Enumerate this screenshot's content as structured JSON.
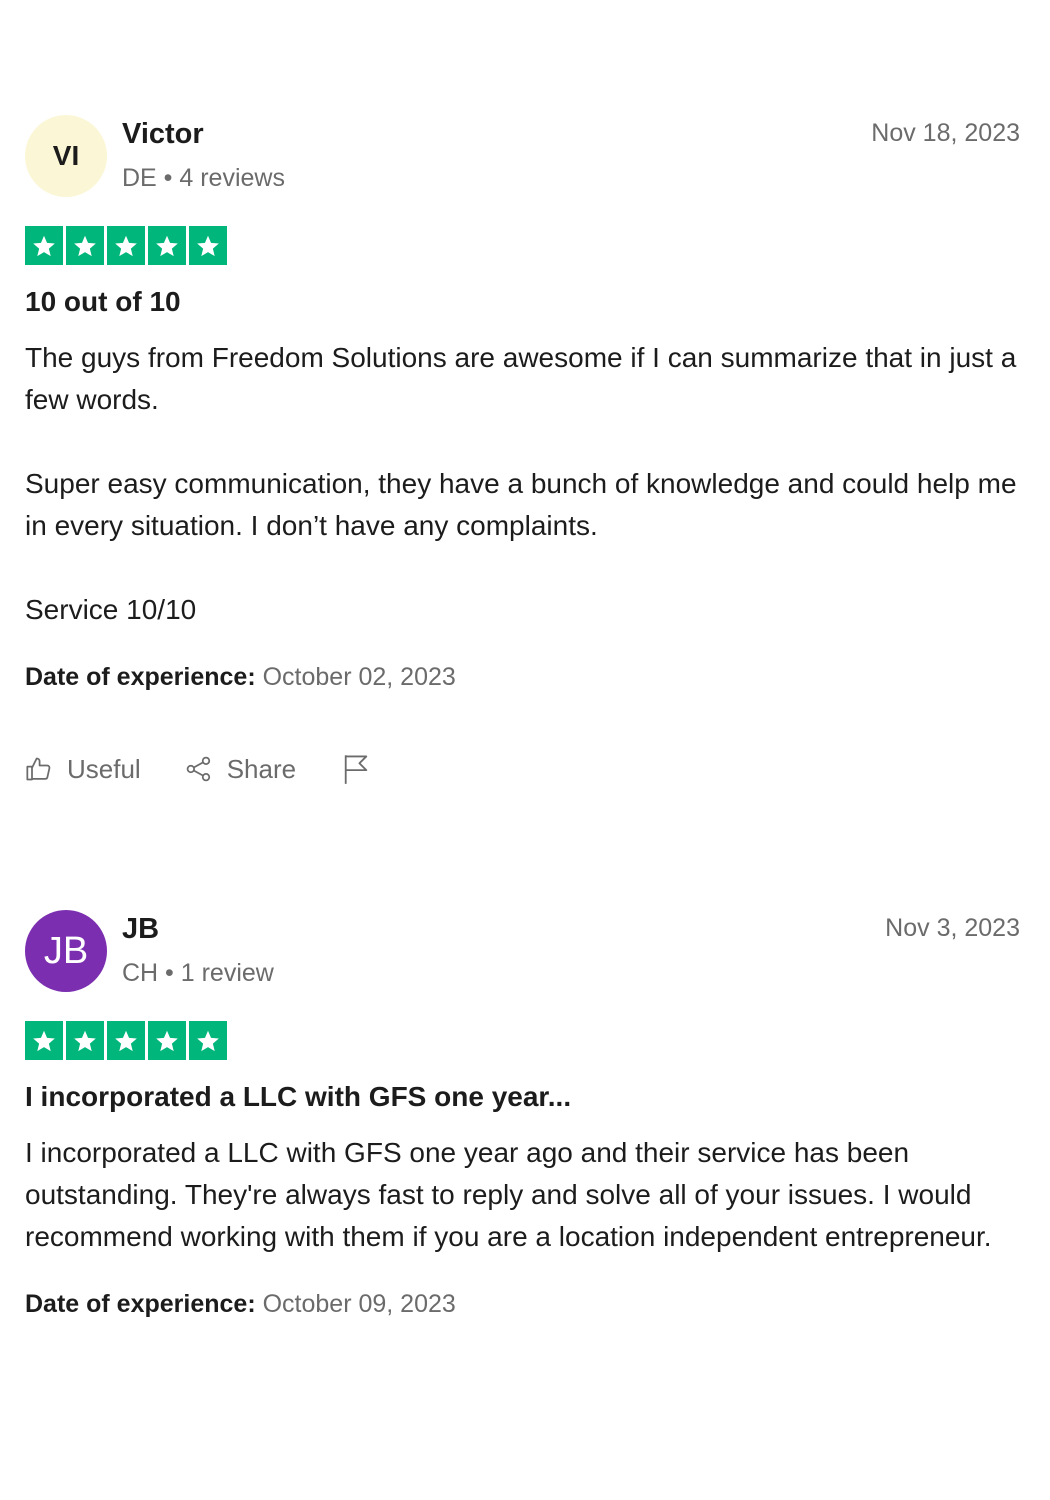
{
  "reviews": [
    {
      "avatar_initials": "VI",
      "name": "Victor",
      "meta": "DE • 4 reviews",
      "date": "Nov 18, 2023",
      "rating": 5,
      "title": "10 out of 10",
      "body": [
        "The guys from Freedom Solutions are awesome if I can summarize that in just a few words.",
        "Super easy communication, they have a bunch of knowledge and could help me in every situation. I don’t have any complaints.",
        "Service 10/10"
      ],
      "experience_label": "Date of experience:",
      "experience_date": "October 02, 2023",
      "actions": {
        "useful_label": "Useful",
        "share_label": "Share"
      }
    },
    {
      "avatar_initials": "JB",
      "name": "JB",
      "meta": "CH • 1 review",
      "date": "Nov 3, 2023",
      "rating": 5,
      "title": "I incorporated a LLC with GFS one year...",
      "body": [
        "I incorporated a LLC with GFS one year ago and their service has been outstanding. They're always fast to reply and solve all of your issues. I would recommend working with them if you are a location independent entrepreneur."
      ],
      "experience_label": "Date of experience:",
      "experience_date": "October 09, 2023"
    }
  ],
  "colors": {
    "star_green": "#00b67a",
    "avatar_purple": "#7b2fb0",
    "avatar_light": "#fbf7d6",
    "muted_text": "#6b6b6b"
  },
  "icons": [
    "thumbs-up-icon",
    "share-icon",
    "flag-icon",
    "star-icon"
  ]
}
